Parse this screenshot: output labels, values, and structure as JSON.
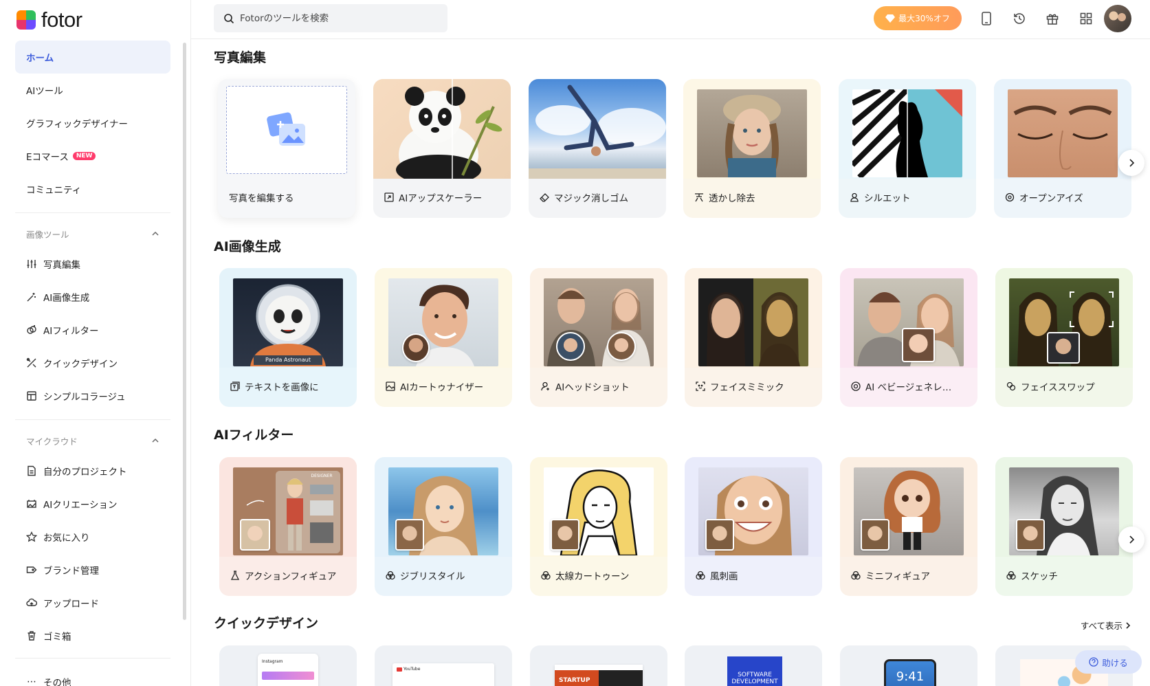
{
  "app": {
    "logo_text": "fotor"
  },
  "sidebar": {
    "main_nav": [
      {
        "label": "ホーム",
        "active": true
      },
      {
        "label": "AIツール"
      },
      {
        "label": "グラフィックデザイナー"
      },
      {
        "label": "Eコマース",
        "badge": "NEW"
      },
      {
        "label": "コミュニティ"
      }
    ],
    "image_tools": {
      "heading": "画像ツール",
      "items": [
        {
          "label": "写真編集",
          "icon": "sliders-icon"
        },
        {
          "label": "AI画像生成",
          "icon": "magic-wand-icon"
        },
        {
          "label": "AIフィルター",
          "icon": "filter-icon"
        },
        {
          "label": "クイックデザイン",
          "icon": "design-tools-icon"
        },
        {
          "label": "シンプルコラージュ",
          "icon": "collage-icon"
        }
      ]
    },
    "my_cloud": {
      "heading": "マイクラウド",
      "items": [
        {
          "label": "自分のプロジェクト",
          "icon": "document-icon"
        },
        {
          "label": "AIクリエーション",
          "icon": "ai-creation-icon"
        },
        {
          "label": "お気に入り",
          "icon": "star-icon"
        },
        {
          "label": "ブランド管理",
          "icon": "tag-icon"
        },
        {
          "label": "アップロード",
          "icon": "cloud-upload-icon"
        },
        {
          "label": "ゴミ箱",
          "icon": "trash-icon"
        }
      ]
    },
    "more_label": "その他"
  },
  "header": {
    "search_placeholder": "Fotorのツールを検索",
    "promo_label": "最大30%オフ",
    "icons": [
      "mobile-icon",
      "history-icon",
      "gift-icon",
      "apps-grid-icon"
    ]
  },
  "sections": {
    "photo_edit": {
      "title": "写真編集",
      "cards": [
        {
          "label": "写真を編集する"
        },
        {
          "label": "AIアップスケーラー"
        },
        {
          "label": "マジック消しゴム"
        },
        {
          "label": "透かし除去"
        },
        {
          "label": "シルエット"
        },
        {
          "label": "オープンアイズ"
        }
      ]
    },
    "ai_image": {
      "title": "AI画像生成",
      "cards": [
        {
          "label": "テキストを画像に",
          "caption": "Panda Astronaut"
        },
        {
          "label": "AIカートゥナイザー"
        },
        {
          "label": "AIヘッドショット"
        },
        {
          "label": "フェイスミミック"
        },
        {
          "label": "AI ベビージェネレ…"
        },
        {
          "label": "フェイススワップ"
        }
      ]
    },
    "ai_filter": {
      "title": "AIフィルター",
      "cards": [
        {
          "label": "アクションフィギュア",
          "caption": "DESIGNER"
        },
        {
          "label": "ジブリスタイル"
        },
        {
          "label": "太線カートゥーン"
        },
        {
          "label": "風刺画"
        },
        {
          "label": "ミニフィギュア"
        },
        {
          "label": "スケッチ"
        }
      ]
    },
    "quick_design": {
      "title": "クイックデザイン",
      "view_all": "すべて表示",
      "thumbs": [
        "Instagram",
        "YouTube",
        "STARTUP",
        "SOFTWARE DEVELOPMENT",
        "9:41"
      ]
    }
  },
  "help_label": "助ける"
}
